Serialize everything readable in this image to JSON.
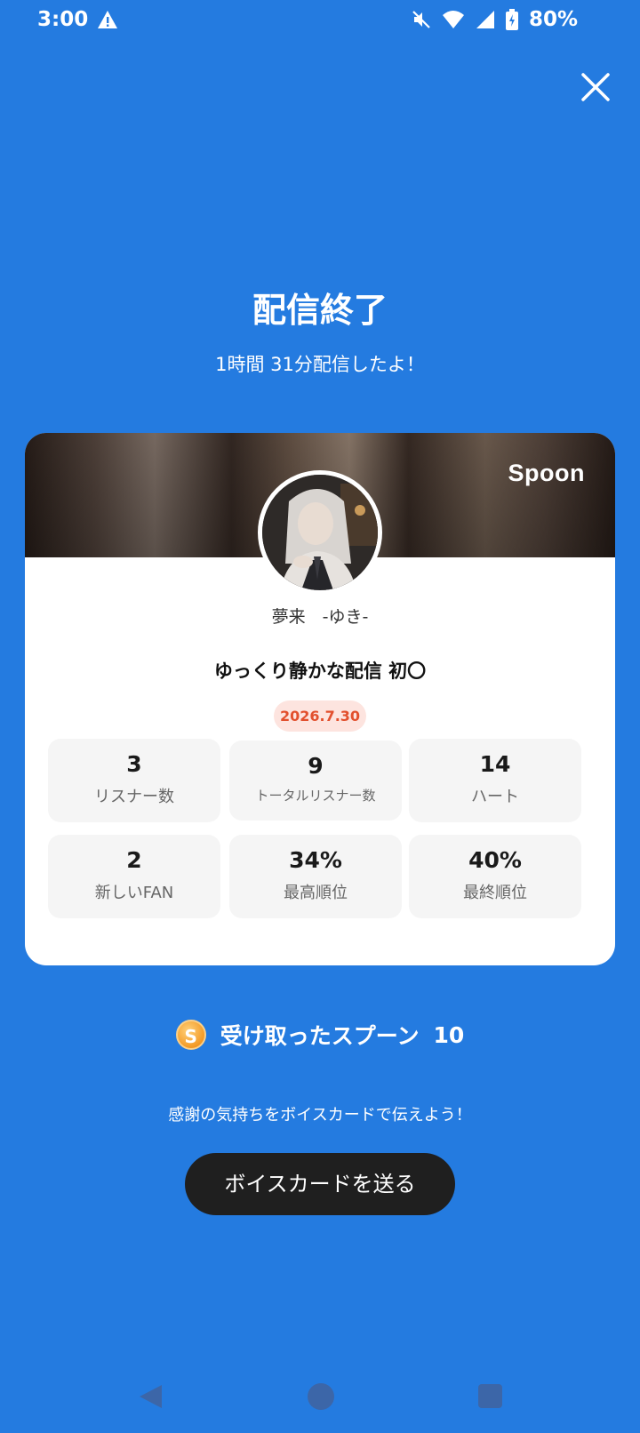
{
  "status_bar": {
    "time": "3:00",
    "battery": "80%"
  },
  "header": {
    "title": "配信終了",
    "subtitle": "1時間 31分配信したよ！"
  },
  "card": {
    "brand": "Spoon",
    "username": "夢来　-ゆき-",
    "stream_title": "ゆっくり静かな配信 初〇",
    "date": "2026.7.30",
    "stats": [
      {
        "value": "3",
        "label": "リスナー数"
      },
      {
        "value": "9",
        "label": "トータルリスナー数"
      },
      {
        "value": "14",
        "label": "ハート"
      },
      {
        "value": "2",
        "label": "新しいFAN"
      },
      {
        "value": "34%",
        "label": "最高順位"
      },
      {
        "value": "40%",
        "label": "最終順位"
      }
    ]
  },
  "spoons": {
    "coin_letter": "S",
    "label": "受け取ったスプーン",
    "count": "10"
  },
  "thanks_text": "感謝の気持ちをボイスカードで伝えよう！",
  "voice_card_button": "ボイスカードを送る",
  "icons": {
    "warning": "warning-icon",
    "mute": "mute-icon",
    "wifi": "wifi-icon",
    "signal": "signal-icon",
    "battery": "battery-icon",
    "close": "close-icon",
    "coin": "coin-icon",
    "back": "back-icon",
    "home": "home-icon",
    "recent": "recent-apps-icon"
  },
  "colors": {
    "background": "#247be0",
    "button": "#1f1f1f",
    "date_badge_text": "#e2502e",
    "date_badge_bg": "#fde4df"
  }
}
